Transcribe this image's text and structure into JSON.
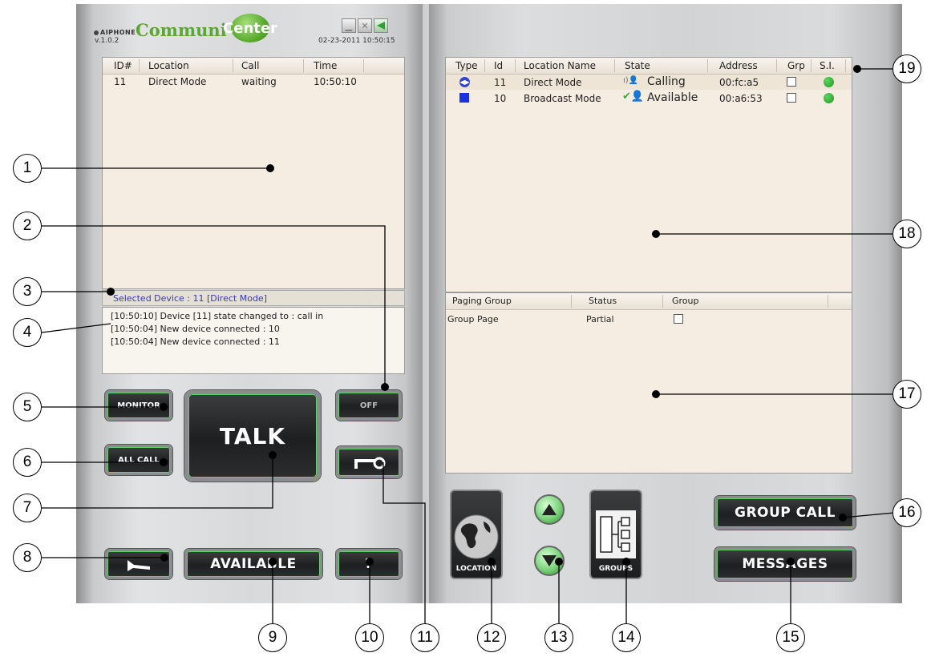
{
  "header": {
    "brand_small": "AIPHONE",
    "brand_main": "Communi",
    "brand_ball": "Center",
    "version": "v.1.0.2",
    "datetime": "02-23-2011 10:50:15"
  },
  "call_list": {
    "columns": [
      "ID#",
      "Location",
      "Call",
      "Time"
    ],
    "rows": [
      {
        "id": "11",
        "location": "Direct Mode",
        "call": "waiting",
        "time": "10:50:10"
      }
    ]
  },
  "selected_device": "Selected Device : 11  [Direct Mode]",
  "log": [
    "[10:50:10] Device [11] state changed to : call in",
    "[10:50:04] New device connected : 10",
    "[10:50:04] New device connected : 11"
  ],
  "device_list": {
    "columns": [
      "Type",
      "Id",
      "Location Name",
      "State",
      "Address",
      "Grp",
      "S.I."
    ],
    "rows": [
      {
        "type_icon": "door-station-icon",
        "id": "11",
        "name": "Direct Mode",
        "state_icon": "calling-icon",
        "state": "Calling",
        "address": "00:fc:a5"
      },
      {
        "type_icon": "blue-square-icon",
        "id": "10",
        "name": "Broadcast Mode",
        "state_icon": "available-icon",
        "state": "Available",
        "address": "00:a6:53"
      }
    ]
  },
  "paging_list": {
    "columns": [
      "Paging Group",
      "Status",
      "Group"
    ],
    "rows": [
      {
        "name": "Group Page",
        "status": "Partial"
      }
    ]
  },
  "buttons": {
    "monitor": "MONITOR",
    "all_call": "ALL CALL",
    "talk": "TALK",
    "off": "OFF",
    "available": "AVAILABLE",
    "help": "?",
    "location": "LOCATION",
    "groups": "GROUPS",
    "group_call": "GROUP CALL",
    "messages": "MESSAGES"
  },
  "callouts": [
    "1",
    "2",
    "3",
    "4",
    "5",
    "6",
    "7",
    "8",
    "9",
    "10",
    "11",
    "12",
    "13",
    "14",
    "15",
    "16",
    "17",
    "18",
    "19"
  ],
  "colors": {
    "accent_green": "#5aa831",
    "status_green": "#1b9a1b",
    "selected_text": "#3a3aa8"
  }
}
